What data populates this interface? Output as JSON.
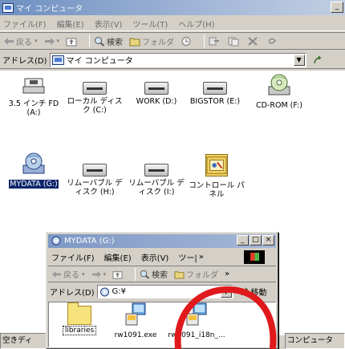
{
  "outer": {
    "title": "マイ コンピュータ",
    "title_btn": "_",
    "menu": [
      "ファイル(F)",
      "編集(E)",
      "表示(V)",
      "ツール(T)",
      "ヘルプ(H)"
    ],
    "toolbar": {
      "back": "戻る",
      "search": "検索",
      "folders": "フォルダ"
    },
    "address": {
      "label": "アドレス(D)",
      "value": "マイ コンピュータ"
    },
    "drives": [
      {
        "label": "3.5 インチ FD (A:)",
        "icon": "floppy-icon"
      },
      {
        "label": "ローカル ディスク (C:)",
        "icon": "hard-disk-icon"
      },
      {
        "label": "WORK (D:)",
        "icon": "hard-disk-icon"
      },
      {
        "label": "BIGSTOR (E:)",
        "icon": "hard-disk-icon"
      },
      {
        "label": "CD-ROM (F:)",
        "icon": "cd-icon"
      },
      {
        "label": "MYDATA (G:)",
        "icon": "cd-icon",
        "selected": true
      },
      {
        "label": "リムーバブル ディスク (H:)",
        "icon": "removable-disk-icon"
      },
      {
        "label": "リムーバブル ディスク (I:)",
        "icon": "removable-disk-icon"
      },
      {
        "label": "コントロール パネル",
        "icon": "control-panel-icon"
      }
    ],
    "status_left": "空きディ",
    "status_right": "コンピュータ"
  },
  "inner": {
    "title": "MYDATA (G:)",
    "buttons": [
      "_",
      "□",
      "×"
    ],
    "menu": [
      "ファイル(F)",
      "編集(E)",
      "表示(V)",
      "ツー|",
      "»"
    ],
    "toolbar": {
      "back": "戻る",
      "search": "検索",
      "folders": "フォルダ",
      "more": "»"
    },
    "address": {
      "label": "アドレス(D)",
      "value": "G:¥",
      "go": "移動"
    },
    "files": [
      {
        "label": "libraries",
        "type": "folder"
      },
      {
        "label": "rw1091.exe",
        "type": "exe"
      },
      {
        "label": "rw1091_i18n_...",
        "type": "exe"
      }
    ]
  },
  "colors": {
    "titlebar": "#6e8fc0",
    "selection": "#0a246a",
    "highlight_circle": "#e0191c",
    "window_face": "#d4d0c8"
  }
}
